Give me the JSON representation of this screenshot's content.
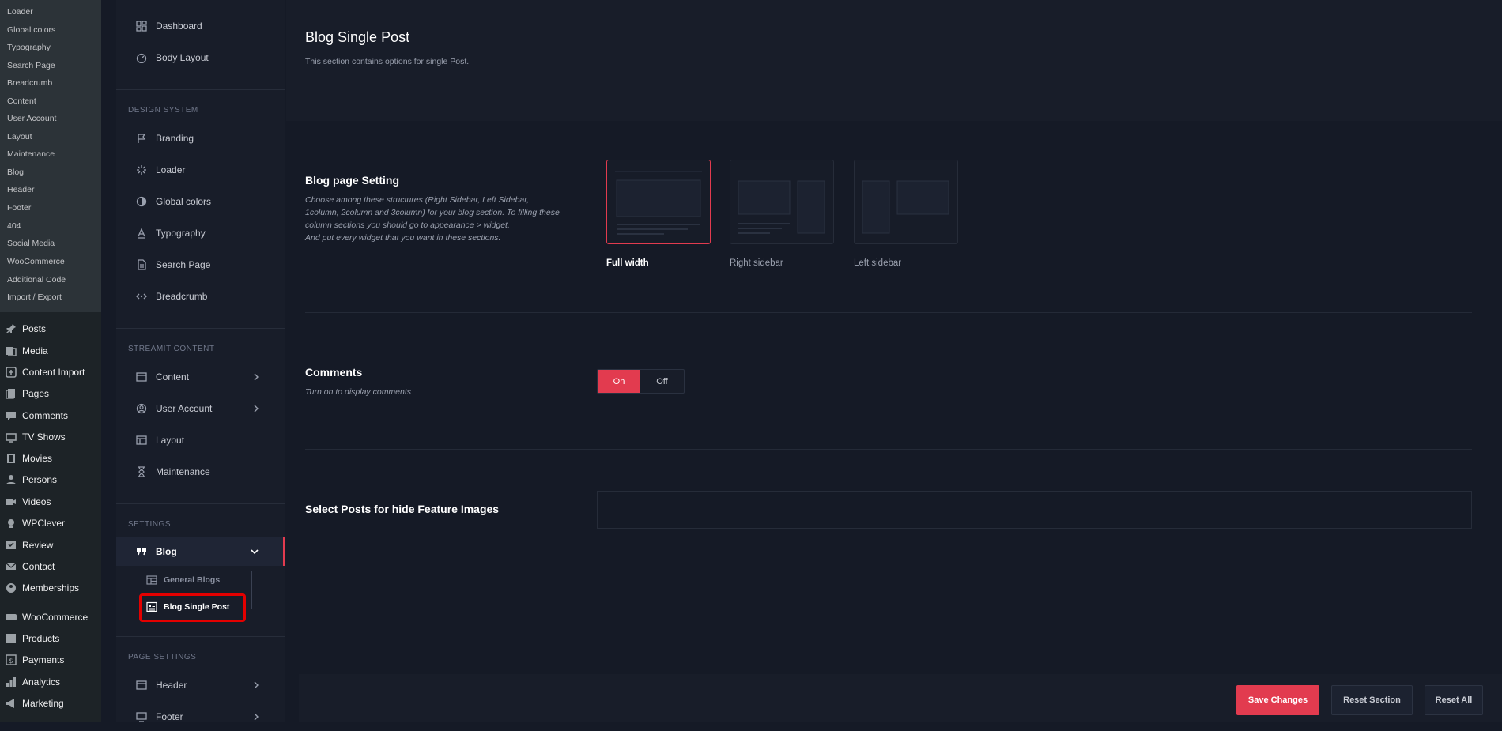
{
  "wp_submenu": [
    "Loader",
    "Global colors",
    "Typography",
    "Search Page",
    "Breadcrumb",
    "Content",
    "User Account",
    "Layout",
    "Maintenance",
    "Blog",
    "Header",
    "Footer",
    "404",
    "Social Media",
    "WooCommerce",
    "Additional Code",
    "Import / Export"
  ],
  "wp_menu": [
    {
      "label": "Posts",
      "icon": "pin-icon"
    },
    {
      "label": "Media",
      "icon": "media-icon"
    },
    {
      "label": "Content Import",
      "icon": "import-icon"
    },
    {
      "label": "Pages",
      "icon": "pages-icon"
    },
    {
      "label": "Comments",
      "icon": "comment-icon"
    },
    {
      "label": "TV Shows",
      "icon": "tv-icon"
    },
    {
      "label": "Movies",
      "icon": "film-icon"
    },
    {
      "label": "Persons",
      "icon": "person-icon"
    },
    {
      "label": "Videos",
      "icon": "video-icon"
    },
    {
      "label": "WPClever",
      "icon": "bulb-icon"
    },
    {
      "label": "Review",
      "icon": "review-icon"
    },
    {
      "label": "Contact",
      "icon": "mail-icon"
    },
    {
      "label": "Memberships",
      "icon": "members-icon"
    },
    {
      "label": "WooCommerce",
      "icon": "woo-icon"
    },
    {
      "label": "Products",
      "icon": "products-icon"
    },
    {
      "label": "Payments",
      "icon": "payments-icon"
    },
    {
      "label": "Analytics",
      "icon": "analytics-icon"
    },
    {
      "label": "Marketing",
      "icon": "megaphone-icon"
    }
  ],
  "panel": {
    "top_items": [
      {
        "label": "Dashboard",
        "icon": "dashboard-icon"
      },
      {
        "label": "Body Layout",
        "icon": "gauge-icon"
      }
    ],
    "design_system": {
      "title": "DESIGN SYSTEM",
      "items": [
        {
          "label": "Branding",
          "icon": "flag-icon"
        },
        {
          "label": "Loader",
          "icon": "loader-icon"
        },
        {
          "label": "Global colors",
          "icon": "color-drop-icon"
        },
        {
          "label": "Typography",
          "icon": "typography-icon"
        },
        {
          "label": "Search Page",
          "icon": "document-icon"
        },
        {
          "label": "Breadcrumb",
          "icon": "breadcrumb-icon"
        }
      ]
    },
    "streamit_content": {
      "title": "STREAMIT CONTENT",
      "items": [
        {
          "label": "Content",
          "icon": "window-icon"
        },
        {
          "label": "User Account",
          "icon": "user-circle-icon"
        },
        {
          "label": "Layout",
          "icon": "layout-icon"
        },
        {
          "label": "Maintenance",
          "icon": "hourglass-icon"
        }
      ]
    },
    "settings": {
      "title": "SETTINGS",
      "blog": "Blog",
      "sub": [
        "General Blogs",
        "Blog Single Post"
      ]
    },
    "page_settings": {
      "title": "PAGE SETTINGS",
      "items": [
        {
          "label": "Header",
          "icon": "window-icon"
        },
        {
          "label": "Footer",
          "icon": "monitor-icon"
        }
      ]
    }
  },
  "content": {
    "title": "Blog Single Post",
    "description": "This section contains options for single Post.",
    "blog_setting": {
      "title": "Blog page Setting",
      "desc1": "Choose among these structures (Right Sidebar, Left Sidebar,",
      "desc2": "1column, 2column and 3column) for your blog section. To filling these",
      "desc3": "column sections you should go to appearance > widget.",
      "desc4": "And put every widget that you want in these sections.",
      "options": [
        "Full width",
        "Right sidebar",
        "Left sidebar"
      ],
      "selected": "Full width"
    },
    "comments": {
      "title": "Comments",
      "description": "Turn on to display comments",
      "on": "On",
      "off": "Off",
      "value": "On"
    },
    "hide_feature": {
      "title": "Select Posts for hide Feature Images"
    }
  },
  "footer": {
    "save": "Save Changes",
    "reset_section": "Reset Section",
    "reset_all": "Reset All"
  },
  "colors": {
    "accent": "#e23b4f",
    "background": "#151a26",
    "panel": "#181d29",
    "highlight_box": "#e30000"
  }
}
